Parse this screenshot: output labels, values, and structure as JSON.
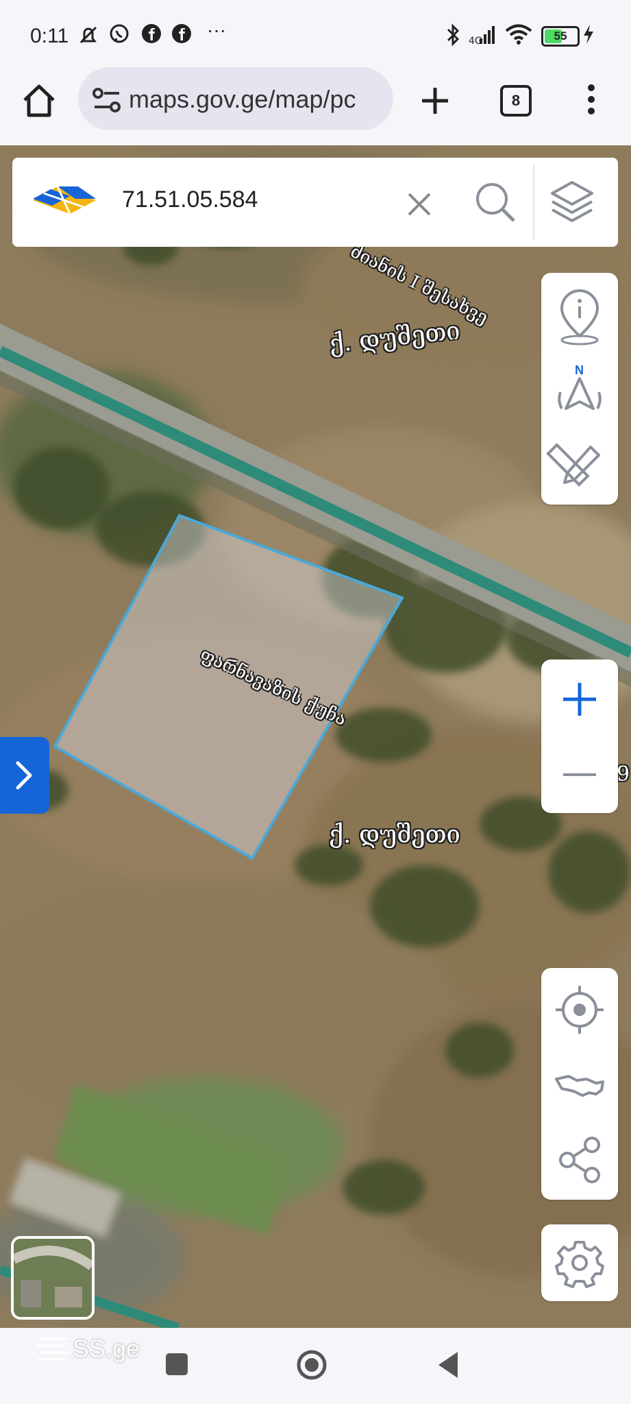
{
  "status_bar": {
    "time": "0:11",
    "more": "···",
    "battery": "55",
    "battery_level": 0.55
  },
  "browser": {
    "url": "maps.gov.ge/map/pc",
    "tab_count": "8"
  },
  "search": {
    "value": "71.51.05.584"
  },
  "map": {
    "labels": {
      "town_top": "ქ. დუშეთი",
      "town_center": "ქ. დუშეთი",
      "street_main": "ფარნავაზის ქუჩა",
      "street_top": "ძიანის I შესახვე",
      "edge_char": "9"
    },
    "parcel_color": "#4aa8d8"
  },
  "watermark": "SS.ge",
  "colors": {
    "accent": "#1565d8",
    "road_line": "#2e8b7a"
  }
}
